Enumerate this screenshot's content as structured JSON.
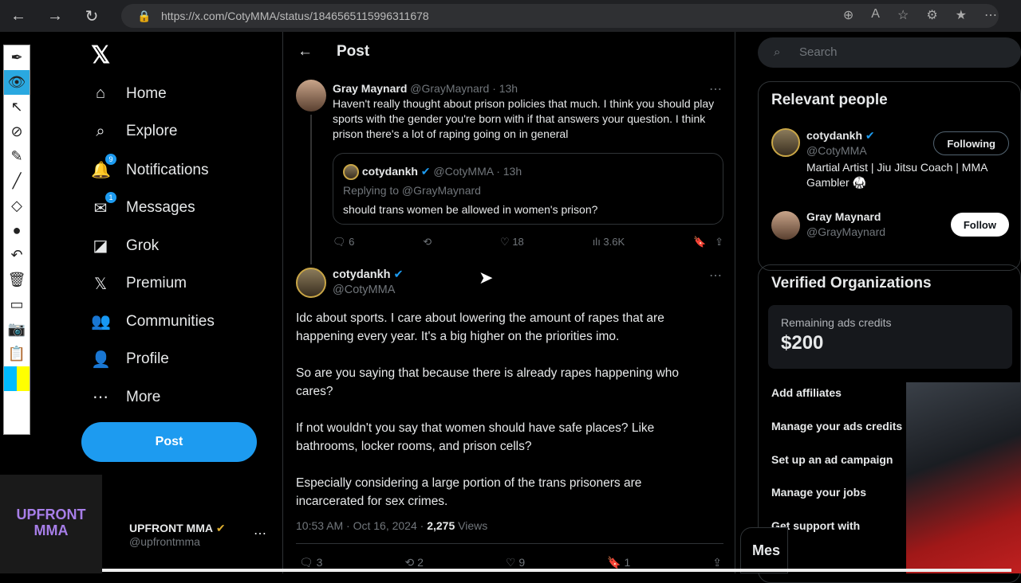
{
  "browser": {
    "url": "https://x.com/CotyMMA/status/1846565115996311678"
  },
  "nav": {
    "items": [
      {
        "label": "Home",
        "icon": "⌂"
      },
      {
        "label": "Explore",
        "icon": "⌕"
      },
      {
        "label": "Notifications",
        "icon": "🔔",
        "badge": "9"
      },
      {
        "label": "Messages",
        "icon": "✉",
        "badge": "1"
      },
      {
        "label": "Grok",
        "icon": "◪"
      },
      {
        "label": "Premium",
        "icon": "𝕏"
      },
      {
        "label": "Communities",
        "icon": "👥"
      },
      {
        "label": "Profile",
        "icon": "👤"
      },
      {
        "label": "More",
        "icon": "⋯"
      }
    ],
    "post_label": "Post"
  },
  "account": {
    "name": "UPFRONT MMA",
    "handle": "@upfrontmma",
    "logo_text": "UPFRONT MMA"
  },
  "header": {
    "title": "Post"
  },
  "reply": {
    "name": "Gray Maynard",
    "handle": "@GrayMaynard",
    "time": "· 13h",
    "text": "Haven't really thought about prison policies that much. I think you should play sports with the gender you're born with if that answers your question. I think prison there's a lot of raping going on in general",
    "quote": {
      "name": "cotydankh",
      "handle": "@CotyMMA · 13h",
      "replying": "Replying to @GrayMaynard",
      "text": "should trans women be allowed in women's prison?"
    },
    "stats": {
      "replies": "6",
      "likes": "18",
      "views": "3.6K"
    }
  },
  "main_post": {
    "name": "cotydankh",
    "handle": "@CotyMMA",
    "paragraphs": [
      "Idc about sports. I care about lowering the amount of rapes that are happening every year. It's a big higher on the priorities imo.",
      "So are you saying that because there is already rapes happening who cares?",
      "If not wouldn't you say that women should have safe places? Like bathrooms, locker rooms, and prison cells?",
      "Especially considering a large portion of the trans prisoners are incarcerated for sex crimes."
    ],
    "timestamp": "10:53 AM · Oct 16, 2024 · ",
    "views_count": "2,275",
    "views_label": " Views",
    "stats": {
      "replies": "3",
      "reposts": "2",
      "likes": "9",
      "bookmarks": "1"
    }
  },
  "right": {
    "search_placeholder": "Search",
    "relevant_title": "Relevant people",
    "people": [
      {
        "name": "cotydankh",
        "handle": "@CotyMMA",
        "bio": "Martial Artist | Jiu Jitsu Coach | MMA Gambler 🥋",
        "button": "Following"
      },
      {
        "name": "Gray Maynard",
        "handle": "@GrayMaynard",
        "button": "Follow"
      }
    ],
    "verified_title": "Verified Organizations",
    "credits_label": "Remaining ads credits",
    "credits_value": "$200",
    "links": [
      "Add affiliates",
      "Manage your ads credits",
      "Set up an ad campaign",
      "Manage your jobs",
      "Get support with"
    ]
  },
  "messages_drawer": "Mes",
  "colors": {
    "accent": "#1d9bf0",
    "background": "#000000"
  }
}
